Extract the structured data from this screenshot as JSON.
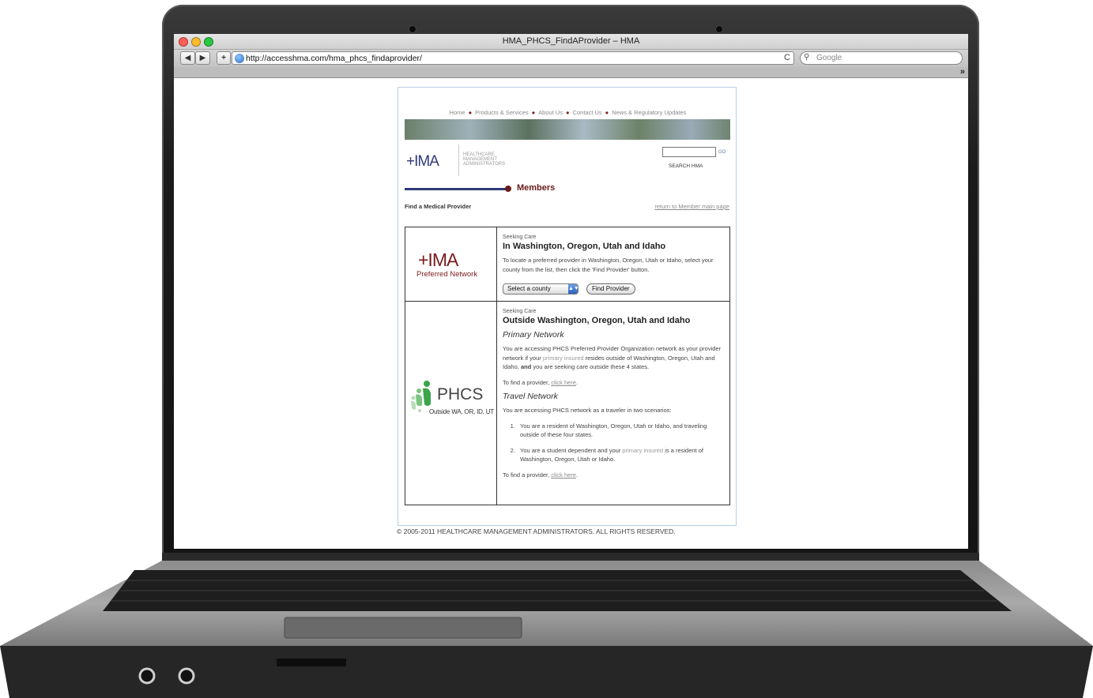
{
  "browser": {
    "window_title": "HMA_PHCS_FindAProvider – HMA",
    "url": "http://accesshma.com/hma_phcs_findaprovider/",
    "search_placeholder": "Google",
    "back_glyph": "◀",
    "forward_glyph": "▶",
    "add_glyph": "+",
    "reload_glyph": "C",
    "overflow_glyph": "»"
  },
  "site": {
    "nav": [
      "Home",
      "Products & Services",
      "About Us",
      "Contact Us",
      "News & Regulatory Updates"
    ],
    "nav_separator": "●",
    "logo": "+IMA",
    "logo_sub": "HEALTHCARE MANAGEMENT ADMINISTRATORS",
    "search_go": "GO",
    "search_label": "SEARCH HMA",
    "section": "Members",
    "page_label": "Find a Medical Provider",
    "return_link": "return to Member main page"
  },
  "hma_section": {
    "logo": "+IMA",
    "logo_sub": "Preferred Network",
    "seeking": "Seeking Care",
    "heading": "In Washington, Oregon, Utah and Idaho",
    "desc": "To locate a preferred provider in Washington, Oregon, Utah or Idaho, select your county from the list, then click the 'Find Provider' button.",
    "select_value": "Select a county",
    "find_button": "Find Provider"
  },
  "phcs_section": {
    "logo": "PHCS",
    "logo_sub": "Outside WA, OR, ID, UT",
    "seeking": "Seeking Care",
    "heading": "Outside Washington, Oregon, Utah and Idaho",
    "primary_title": "Primary Network",
    "primary_a": "You are accessing PHCS Preferred Provider Organization network as your provider network if your ",
    "primary_link": "primary insured",
    "primary_b": " resides outside of Washington, Oregon, Utah and Idaho, ",
    "primary_and": "and",
    "primary_c": " you are seeking care outside these 4 states.",
    "find_prefix": "To find a provider, ",
    "click_here": "click here",
    "period": ".",
    "travel_title": "Travel Network",
    "travel_desc": "You are accessing PHCS network as a traveler in two scenarios:",
    "item1": "You are a resident of Washington, Oregon, Utah or Idaho, and traveling outside of these four states.",
    "item2_a": "You are a student dependent and your ",
    "item2_link": "primary insured",
    "item2_b": " is a resident of Washington, Oregon, Utah or Idaho."
  },
  "footer": "© 2005-2011 HEALTHCARE MANAGEMENT ADMINISTRATORS. ALL RIGHTS RESERVED.",
  "colors": {
    "hma_blue": "#2f3a78",
    "hma_maroon": "#7a1b1b",
    "phcs_green": "#3aa54a"
  }
}
